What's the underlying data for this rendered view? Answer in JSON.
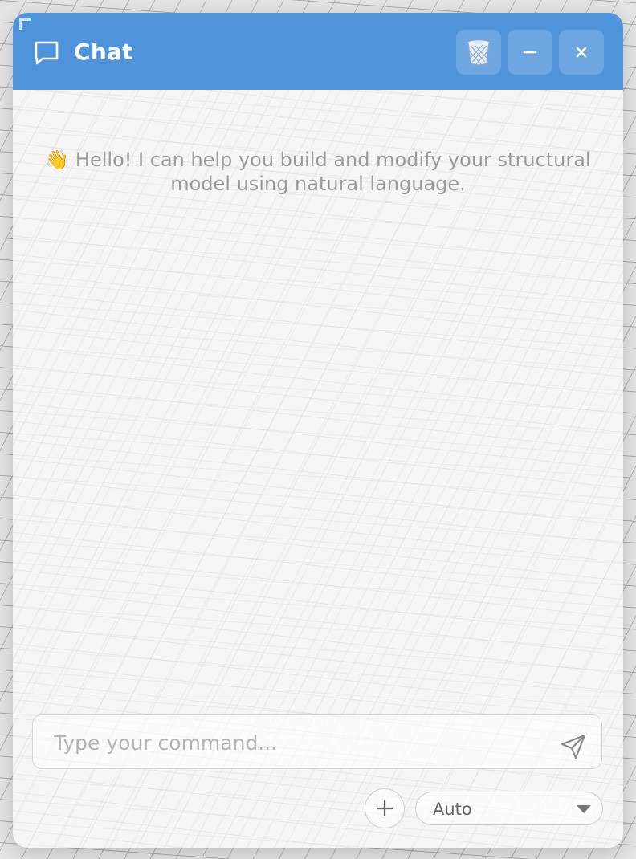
{
  "header": {
    "title": "Chat",
    "icons": {
      "chat": "chat-bubble-icon",
      "clear": "trash-icon",
      "minimize": "minimize-icon",
      "close": "close-icon"
    },
    "close_glyph": "✕",
    "accent_color": "#4f93db"
  },
  "messages": {
    "greeting": "👋 Hello! I can help you build and modify your structural model using natural language."
  },
  "composer": {
    "placeholder": "Type your command...",
    "value": "",
    "send_icon": "send-icon",
    "attach_icon": "plus-icon",
    "attach_glyph": "+",
    "mode_value": "Auto"
  }
}
